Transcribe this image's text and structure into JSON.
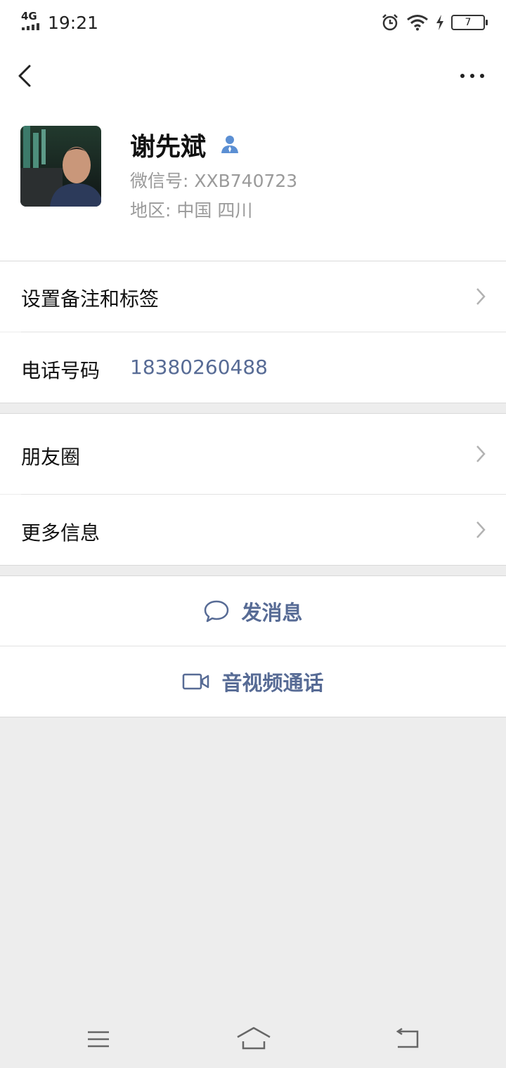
{
  "status_bar": {
    "network": "4G",
    "time": "19:21",
    "battery": "7"
  },
  "profile": {
    "name": "谢先斌",
    "wechat_id": "微信号: XXB740723",
    "region": "地区: 中国  四川"
  },
  "menu": {
    "remark_label": "设置备注和标签",
    "phone_label": "电话号码",
    "phone_value": "18380260488",
    "moments_label": "朋友圈",
    "more_info_label": "更多信息"
  },
  "actions": {
    "message_label": "发消息",
    "call_label": "音视频通话"
  },
  "colors": {
    "link": "#576b95",
    "badge": "#5b8fd3"
  }
}
